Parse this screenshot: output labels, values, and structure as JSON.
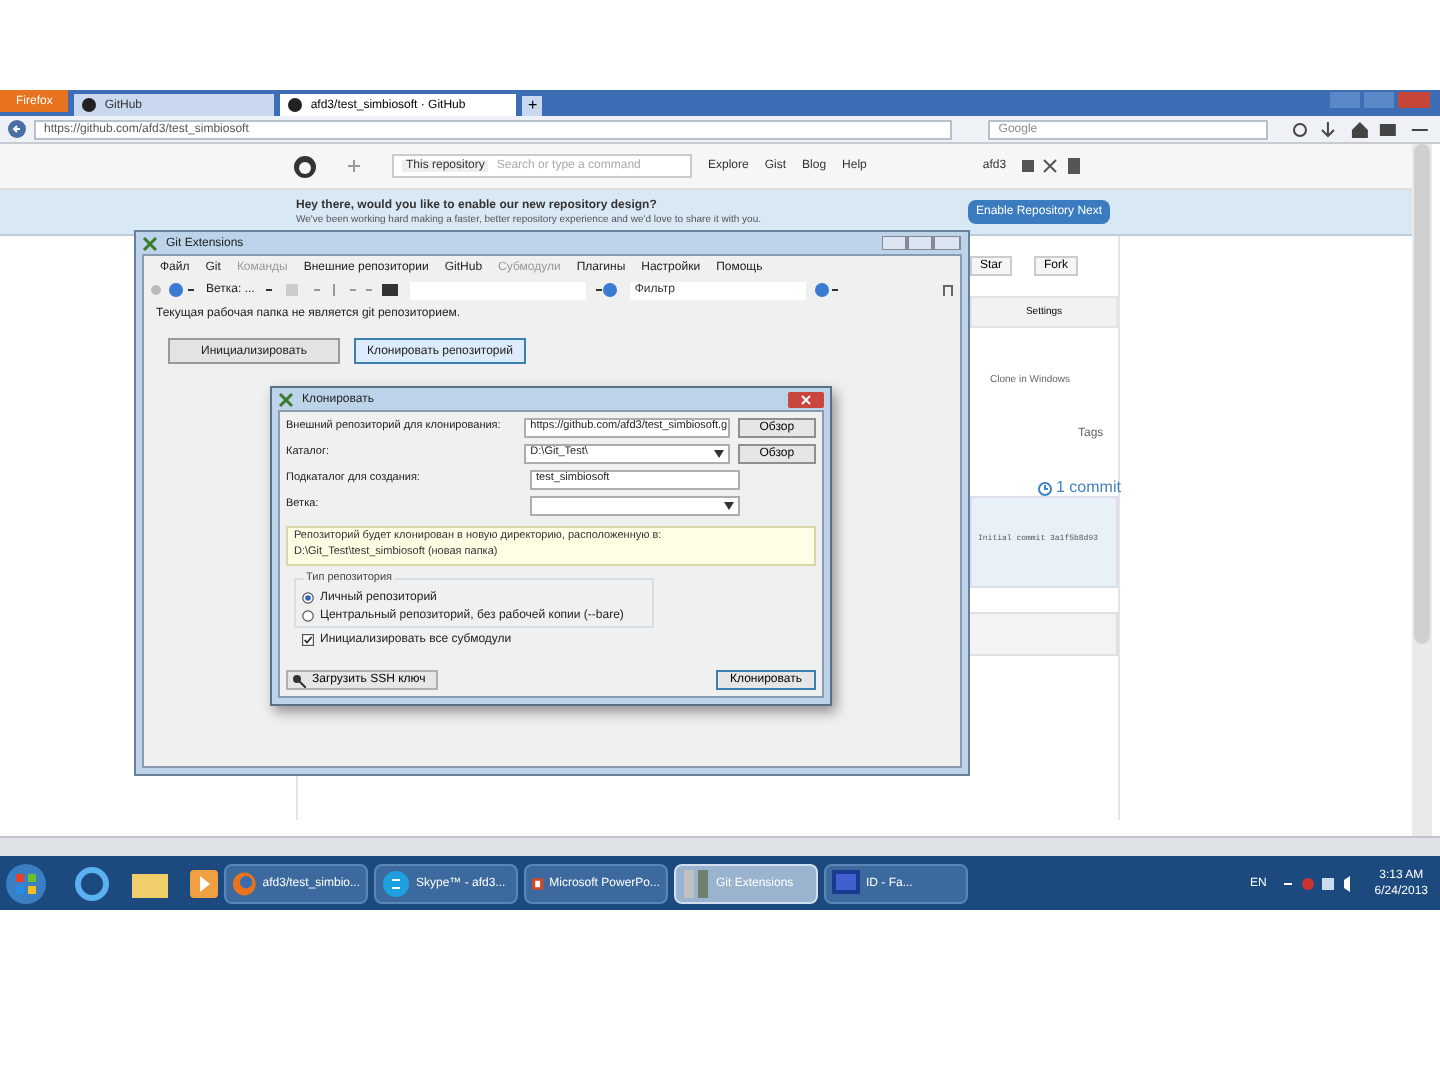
{
  "browser": {
    "menu_button": "Firefox",
    "tabs": [
      {
        "label": "GitHub",
        "selected": false
      },
      {
        "label": "afd3/test_simbiosoft · GitHub",
        "selected": true
      }
    ],
    "new_tab": "+",
    "url": "https://github.com/afd3/test_simbiosoft",
    "search_placeholder": "Google"
  },
  "github": {
    "scope": "This repository",
    "search_placeholder": "Search or type a command",
    "links": [
      "Explore",
      "Gist",
      "Blog",
      "Help"
    ],
    "user": "afd3",
    "banner_title": "Hey there, would you like to enable our new repository design?",
    "banner_text": "We've been working hard making a faster, better repository experience and we'd love to share it with you.",
    "banner_button": "Enable Repository Next",
    "star": "Star",
    "fork": "Fork",
    "settings": "Settings",
    "clone_label": "Clone in Windows",
    "tags": "Tags",
    "commits": "1 commit",
    "last_commit": "Initial commit 3a1f5b8d93"
  },
  "git_extensions": {
    "title": "Git Extensions",
    "menu": [
      {
        "label": "Файл",
        "disabled": false
      },
      {
        "label": "Git",
        "disabled": false
      },
      {
        "label": "Команды",
        "disabled": true
      },
      {
        "label": "Внешние репозитории",
        "disabled": false
      },
      {
        "label": "GitHub",
        "disabled": false
      },
      {
        "label": "Субмодули",
        "disabled": true
      },
      {
        "label": "Плагины",
        "disabled": false
      },
      {
        "label": "Настройки",
        "disabled": false
      },
      {
        "label": "Помощь",
        "disabled": false
      }
    ],
    "branch": "Ветка: ...",
    "filter_label": "Фильтр",
    "message": "Текущая рабочая папка не является git репозиторием.",
    "buttons": [
      {
        "label": "Инициализировать",
        "focused": false
      },
      {
        "label": "Клонировать репозиторий",
        "focused": true
      }
    ]
  },
  "clone_dialog": {
    "title": "Клонировать",
    "fields": [
      {
        "kind": "combo",
        "label": "Внешний репозиторий для клонирования:",
        "value": "https://github.com/afd3/test_simbiosoft.g",
        "button": "Обзор"
      },
      {
        "kind": "combo",
        "label": "Каталог:",
        "value": "D:\\Git_Test\\",
        "button": "Обзор"
      },
      {
        "kind": "text",
        "label": "Подкаталог для создания:",
        "value": "test_simbiosoft"
      },
      {
        "kind": "combo",
        "label": "Ветка:"
      }
    ],
    "info": "Репозиторий будет клонирован в новую директорию, расположенную в:",
    "info_path": "D:\\Git_Test\\test_simbiosoft (новая папка)",
    "repo_type_legend": "Тип репозитория",
    "repo_types": [
      {
        "label": "Личный репозиторий",
        "selected": true
      },
      {
        "label": "Центральный репозиторий, без рабочей копии (--bare)",
        "selected": false
      }
    ],
    "submodules": {
      "label": "Инициализировать все субмодули",
      "checked": true
    },
    "ssh_button": "Загрузить SSH ключ",
    "clone_button": "Клонировать"
  },
  "taskbar": {
    "items": [
      {
        "kind": "firefox",
        "label": "afd3/test_simbio...",
        "active": false
      },
      {
        "kind": "skype",
        "label": "Skype™ - afd3...",
        "active": false
      },
      {
        "kind": "powerpoint",
        "label": "Microsoft PowerPo...",
        "active": false
      },
      {
        "kind": "git",
        "label": "Git Extensions",
        "active": true
      },
      {
        "kind": "app",
        "label": "ID - Fa...",
        "active": false
      }
    ],
    "language": "EN",
    "time": "3:13 AM",
    "date": "6/24/2013"
  }
}
